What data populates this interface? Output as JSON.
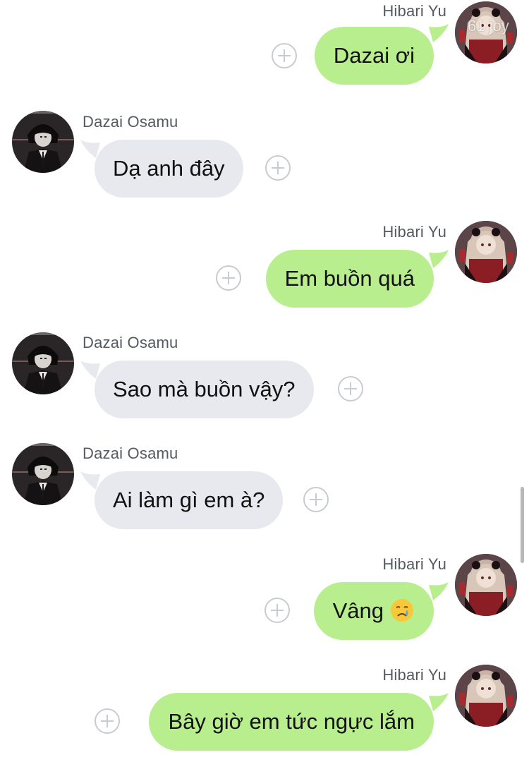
{
  "chat": {
    "messages": [
      {
        "direction": "out",
        "sender": "Hibari Yu",
        "text": "Dazai ơi"
      },
      {
        "direction": "in",
        "sender": "Dazai Osamu",
        "text": "Dạ anh đây"
      },
      {
        "direction": "out",
        "sender": "Hibari Yu",
        "text": "Em buồn quá"
      },
      {
        "direction": "in",
        "sender": "Dazai Osamu",
        "text": "Sao mà buồn vậy?"
      },
      {
        "direction": "in",
        "sender": "Dazai Osamu",
        "text": "Ai làm gì em à?"
      },
      {
        "direction": "out",
        "sender": "Hibari Yu",
        "text": "Vâng",
        "emoji": "crying-face"
      },
      {
        "direction": "out",
        "sender": "Hibari Yu",
        "text": "Bây giờ em tức ngực lắm"
      }
    ],
    "watermark": "61 joy"
  },
  "colors": {
    "outgoing_bubble": "#b9ee8e",
    "incoming_bubble": "#e7e9ee",
    "sender_name": "#555a60",
    "add_icon": "#c8cbd0"
  },
  "icons": {
    "add": "plus-circle-icon",
    "reaction": "crying-face-emoji"
  }
}
